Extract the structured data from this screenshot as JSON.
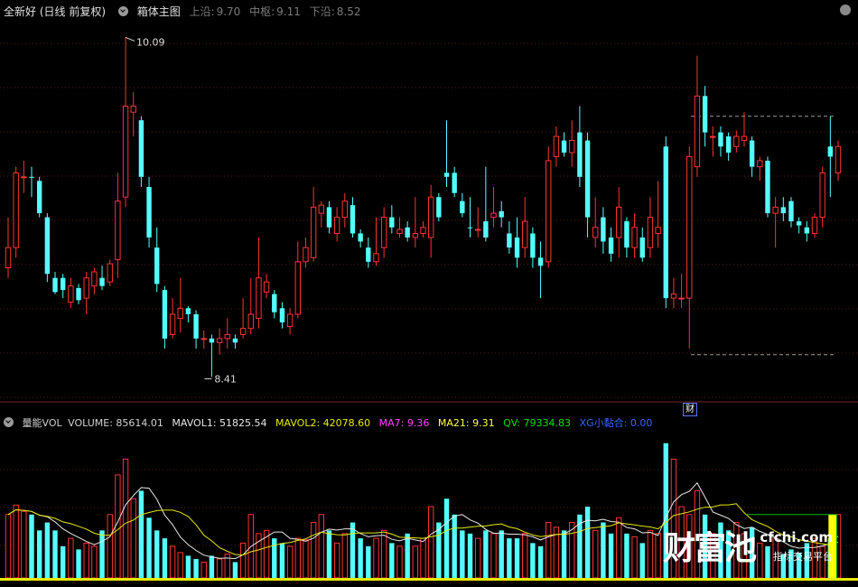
{
  "colors": {
    "up": "#ff3232",
    "down": "#54ffff",
    "bg": "#000000",
    "grid": "#5a1a1a",
    "ma_white": "#e8e8e8",
    "ma_yellow": "#e8e800",
    "mavol2": "#e8e800",
    "ma7": "#ff44ff",
    "ma21": "#ffff44",
    "qv": "#00e000",
    "xg": "#3366ff"
  },
  "price_panel": {
    "stock_name": "全新好",
    "period": "(日线 前复权)",
    "indicator": "箱体主图",
    "upper_label": "上沿:",
    "upper_value": "9.70",
    "center_label": "中枢:",
    "center_value": "9.11",
    "lower_label": "下沿:",
    "lower_value": "8.52",
    "high_marker": "10.09",
    "low_marker": "8.41",
    "finance_badge": "财",
    "icon_expand": "chevron-down-icon"
  },
  "volume_panel": {
    "indicator": "量能VOL",
    "volume": "VOLUME: 85614.01",
    "mavol1": "MAVOL1: 51825.54",
    "mavol2": "MAVOL2: 42078.60",
    "ma7": "MA7: 9.36",
    "ma21": "MA21: 9.31",
    "qv": "QV: 79334.83",
    "xg": "XG小黏合: 0.00",
    "icon_expand": "chevron-down-icon"
  },
  "watermark": {
    "brand": "财富池",
    "site": "cfchi.com",
    "slogan": "指标交易平台"
  },
  "chart_data": {
    "type": "candlestick",
    "price_range": [
      8.3,
      10.15
    ],
    "box": {
      "upper": 9.7,
      "center": 9.11,
      "lower": 8.52
    },
    "candles": [
      {
        "o": 8.95,
        "c": 9.05,
        "h": 9.2,
        "l": 8.9,
        "v": 40000,
        "up": true
      },
      {
        "o": 9.05,
        "c": 9.42,
        "h": 9.45,
        "l": 9.0,
        "v": 46000,
        "up": true
      },
      {
        "o": 9.4,
        "c": 9.4,
        "h": 9.48,
        "l": 9.32,
        "v": 42000,
        "up": true
      },
      {
        "o": 9.4,
        "c": 9.4,
        "h": 9.45,
        "l": 9.3,
        "v": 40000,
        "up": false
      },
      {
        "o": 9.38,
        "c": 9.22,
        "h": 9.4,
        "l": 9.2,
        "v": 30000,
        "up": false
      },
      {
        "o": 9.2,
        "c": 8.92,
        "h": 9.22,
        "l": 8.88,
        "v": 35000,
        "up": false
      },
      {
        "o": 8.9,
        "c": 8.83,
        "h": 8.93,
        "l": 8.82,
        "v": 30000,
        "up": false
      },
      {
        "o": 8.9,
        "c": 8.84,
        "h": 8.92,
        "l": 8.8,
        "v": 20000,
        "up": false
      },
      {
        "o": 8.78,
        "c": 8.86,
        "h": 8.9,
        "l": 8.75,
        "v": 25000,
        "up": true
      },
      {
        "o": 8.85,
        "c": 8.79,
        "h": 8.87,
        "l": 8.77,
        "v": 18000,
        "up": false
      },
      {
        "o": 8.8,
        "c": 8.9,
        "h": 8.93,
        "l": 8.72,
        "v": 22000,
        "up": true
      },
      {
        "o": 8.86,
        "c": 8.93,
        "h": 8.95,
        "l": 8.82,
        "v": 20000,
        "up": true
      },
      {
        "o": 8.9,
        "c": 8.86,
        "h": 8.96,
        "l": 8.84,
        "v": 30000,
        "up": false
      },
      {
        "o": 8.88,
        "c": 8.97,
        "h": 8.99,
        "l": 8.86,
        "v": 40000,
        "up": true
      },
      {
        "o": 8.99,
        "c": 9.28,
        "h": 9.42,
        "l": 8.9,
        "v": 65000,
        "up": true
      },
      {
        "o": 9.3,
        "c": 9.75,
        "h": 10.09,
        "l": 9.25,
        "v": 75000,
        "up": true
      },
      {
        "o": 9.72,
        "c": 9.75,
        "h": 9.82,
        "l": 9.6,
        "v": 50000,
        "up": true
      },
      {
        "o": 9.68,
        "c": 9.4,
        "h": 9.7,
        "l": 9.35,
        "v": 55000,
        "up": false
      },
      {
        "o": 9.35,
        "c": 9.1,
        "h": 9.4,
        "l": 9.05,
        "v": 38000,
        "up": false
      },
      {
        "o": 9.05,
        "c": 8.87,
        "h": 9.15,
        "l": 8.83,
        "v": 30000,
        "up": false
      },
      {
        "o": 8.84,
        "c": 8.6,
        "h": 8.86,
        "l": 8.55,
        "v": 25000,
        "up": false
      },
      {
        "o": 8.62,
        "c": 8.72,
        "h": 8.8,
        "l": 8.6,
        "v": 20000,
        "up": true
      },
      {
        "o": 8.7,
        "c": 8.75,
        "h": 8.9,
        "l": 8.63,
        "v": 16000,
        "up": true
      },
      {
        "o": 8.72,
        "c": 8.75,
        "h": 8.76,
        "l": 8.68,
        "v": 14000,
        "up": false
      },
      {
        "o": 8.72,
        "c": 8.6,
        "h": 8.74,
        "l": 8.55,
        "v": 12000,
        "up": false
      },
      {
        "o": 8.6,
        "c": 8.6,
        "h": 8.64,
        "l": 8.55,
        "v": 10000,
        "up": true
      },
      {
        "o": 8.6,
        "c": 8.58,
        "h": 8.62,
        "l": 8.41,
        "v": 14000,
        "up": false
      },
      {
        "o": 8.58,
        "c": 8.6,
        "h": 8.65,
        "l": 8.52,
        "v": 12000,
        "up": true
      },
      {
        "o": 8.6,
        "c": 8.62,
        "h": 8.7,
        "l": 8.55,
        "v": 15000,
        "up": true
      },
      {
        "o": 8.6,
        "c": 8.58,
        "h": 8.62,
        "l": 8.55,
        "v": 10000,
        "up": false
      },
      {
        "o": 8.62,
        "c": 8.65,
        "h": 8.8,
        "l": 8.6,
        "v": 22000,
        "up": true
      },
      {
        "o": 8.65,
        "c": 8.72,
        "h": 8.9,
        "l": 8.62,
        "v": 40000,
        "up": true
      },
      {
        "o": 8.7,
        "c": 8.9,
        "h": 9.1,
        "l": 8.65,
        "v": 28000,
        "up": true
      },
      {
        "o": 8.88,
        "c": 8.83,
        "h": 8.92,
        "l": 8.8,
        "v": 30000,
        "up": true
      },
      {
        "o": 8.82,
        "c": 8.73,
        "h": 8.84,
        "l": 8.7,
        "v": 25000,
        "up": false
      },
      {
        "o": 8.75,
        "c": 8.68,
        "h": 8.78,
        "l": 8.65,
        "v": 22000,
        "up": false
      },
      {
        "o": 8.66,
        "c": 8.72,
        "h": 8.75,
        "l": 8.62,
        "v": 20000,
        "up": true
      },
      {
        "o": 8.72,
        "c": 8.98,
        "h": 9.08,
        "l": 8.7,
        "v": 25000,
        "up": true
      },
      {
        "o": 8.98,
        "c": 9.05,
        "h": 9.1,
        "l": 8.95,
        "v": 24000,
        "up": true
      },
      {
        "o": 9.0,
        "c": 9.25,
        "h": 9.35,
        "l": 8.98,
        "v": 35000,
        "up": true
      },
      {
        "o": 9.22,
        "c": 9.26,
        "h": 9.28,
        "l": 9.15,
        "v": 40000,
        "up": true
      },
      {
        "o": 9.25,
        "c": 9.15,
        "h": 9.28,
        "l": 9.12,
        "v": 30000,
        "up": false
      },
      {
        "o": 9.12,
        "c": 9.2,
        "h": 9.25,
        "l": 9.08,
        "v": 22000,
        "up": true
      },
      {
        "o": 9.2,
        "c": 9.28,
        "h": 9.32,
        "l": 9.15,
        "v": 28000,
        "up": true
      },
      {
        "o": 9.26,
        "c": 9.12,
        "h": 9.3,
        "l": 9.1,
        "v": 35000,
        "up": false
      },
      {
        "o": 9.12,
        "c": 9.08,
        "h": 9.14,
        "l": 9.05,
        "v": 25000,
        "up": false
      },
      {
        "o": 9.05,
        "c": 8.98,
        "h": 9.1,
        "l": 8.95,
        "v": 20000,
        "up": false
      },
      {
        "o": 8.98,
        "c": 9.02,
        "h": 9.2,
        "l": 8.96,
        "v": 25000,
        "up": true
      },
      {
        "o": 9.05,
        "c": 9.2,
        "h": 9.25,
        "l": 9.0,
        "v": 30000,
        "up": true
      },
      {
        "o": 9.2,
        "c": 9.15,
        "h": 9.26,
        "l": 9.12,
        "v": 22000,
        "up": false
      },
      {
        "o": 9.14,
        "c": 9.12,
        "h": 9.2,
        "l": 9.1,
        "v": 20000,
        "up": true
      },
      {
        "o": 9.15,
        "c": 9.1,
        "h": 9.18,
        "l": 9.08,
        "v": 28000,
        "up": false
      },
      {
        "o": 9.1,
        "c": 9.12,
        "h": 9.3,
        "l": 9.05,
        "v": 20000,
        "up": true
      },
      {
        "o": 9.12,
        "c": 9.15,
        "h": 9.18,
        "l": 9.1,
        "v": 25000,
        "up": true
      },
      {
        "o": 9.1,
        "c": 9.3,
        "h": 9.36,
        "l": 9.0,
        "v": 45000,
        "up": true
      },
      {
        "o": 9.3,
        "c": 9.2,
        "h": 9.32,
        "l": 9.18,
        "v": 35000,
        "up": false
      },
      {
        "o": 9.4,
        "c": 9.42,
        "h": 9.68,
        "l": 9.35,
        "v": 50000,
        "up": false
      },
      {
        "o": 9.42,
        "c": 9.32,
        "h": 9.45,
        "l": 9.3,
        "v": 40000,
        "up": false
      },
      {
        "o": 9.28,
        "c": 9.22,
        "h": 9.32,
        "l": 9.2,
        "v": 30000,
        "up": false
      },
      {
        "o": 9.15,
        "c": 9.15,
        "h": 9.3,
        "l": 9.1,
        "v": 28000,
        "up": false
      },
      {
        "o": 9.14,
        "c": 9.14,
        "h": 9.25,
        "l": 9.1,
        "v": 25000,
        "up": true
      },
      {
        "o": 9.18,
        "c": 9.1,
        "h": 9.45,
        "l": 9.08,
        "v": 30000,
        "up": false
      },
      {
        "o": 9.2,
        "c": 9.22,
        "h": 9.35,
        "l": 9.15,
        "v": 28000,
        "up": true
      },
      {
        "o": 9.23,
        "c": 9.2,
        "h": 9.28,
        "l": 9.15,
        "v": 30000,
        "up": false
      },
      {
        "o": 9.12,
        "c": 9.05,
        "h": 9.18,
        "l": 9.02,
        "v": 25000,
        "up": false
      },
      {
        "o": 9.1,
        "c": 9.0,
        "h": 9.2,
        "l": 8.95,
        "v": 25000,
        "up": false
      },
      {
        "o": 9.05,
        "c": 9.18,
        "h": 9.3,
        "l": 9.0,
        "v": 28000,
        "up": true
      },
      {
        "o": 9.12,
        "c": 9.0,
        "h": 9.15,
        "l": 8.95,
        "v": 22000,
        "up": false
      },
      {
        "o": 9.0,
        "c": 8.96,
        "h": 9.08,
        "l": 8.8,
        "v": 20000,
        "up": false
      },
      {
        "o": 8.98,
        "c": 9.48,
        "h": 9.55,
        "l": 8.95,
        "v": 35000,
        "up": true
      },
      {
        "o": 9.5,
        "c": 9.6,
        "h": 9.65,
        "l": 9.45,
        "v": 32000,
        "up": true
      },
      {
        "o": 9.58,
        "c": 9.52,
        "h": 9.62,
        "l": 9.5,
        "v": 30000,
        "up": false
      },
      {
        "o": 9.52,
        "c": 9.58,
        "h": 9.68,
        "l": 9.45,
        "v": 35000,
        "up": true
      },
      {
        "o": 9.62,
        "c": 9.4,
        "h": 9.75,
        "l": 9.35,
        "v": 40000,
        "up": false
      },
      {
        "o": 9.58,
        "c": 9.2,
        "h": 9.62,
        "l": 9.1,
        "v": 45000,
        "up": false
      },
      {
        "o": 9.15,
        "c": 9.1,
        "h": 9.3,
        "l": 9.05,
        "v": 30000,
        "up": true
      },
      {
        "o": 9.2,
        "c": 9.08,
        "h": 9.25,
        "l": 9.02,
        "v": 35000,
        "up": false
      },
      {
        "o": 9.1,
        "c": 9.02,
        "h": 9.15,
        "l": 8.98,
        "v": 28000,
        "up": false
      },
      {
        "o": 9.1,
        "c": 9.25,
        "h": 9.35,
        "l": 9.0,
        "v": 38000,
        "up": true
      },
      {
        "o": 9.18,
        "c": 9.05,
        "h": 9.2,
        "l": 9.0,
        "v": 28000,
        "up": false
      },
      {
        "o": 9.05,
        "c": 9.15,
        "h": 9.22,
        "l": 9.0,
        "v": 26000,
        "up": true
      },
      {
        "o": 9.1,
        "c": 9.0,
        "h": 9.15,
        "l": 8.98,
        "v": 22000,
        "up": false
      },
      {
        "o": 9.05,
        "c": 9.2,
        "h": 9.3,
        "l": 9.0,
        "v": 30000,
        "up": true
      },
      {
        "o": 9.15,
        "c": 9.12,
        "h": 9.38,
        "l": 9.05,
        "v": 28000,
        "up": true
      },
      {
        "o": 9.55,
        "c": 8.8,
        "h": 9.6,
        "l": 8.75,
        "v": 85000,
        "up": false
      },
      {
        "o": 8.8,
        "c": 8.82,
        "h": 8.9,
        "l": 8.75,
        "v": 75000,
        "up": true
      },
      {
        "o": 8.8,
        "c": 8.8,
        "h": 8.92,
        "l": 8.75,
        "v": 45000,
        "up": true
      },
      {
        "o": 8.8,
        "c": 9.5,
        "h": 9.55,
        "l": 8.55,
        "v": 40000,
        "up": true
      },
      {
        "o": 9.45,
        "c": 9.8,
        "h": 10.0,
        "l": 9.4,
        "v": 55000,
        "up": true
      },
      {
        "o": 9.8,
        "c": 9.62,
        "h": 9.85,
        "l": 9.55,
        "v": 40000,
        "up": false
      },
      {
        "o": 9.6,
        "c": 9.6,
        "h": 9.65,
        "l": 9.5,
        "v": 28000,
        "up": true
      },
      {
        "o": 9.62,
        "c": 9.55,
        "h": 9.65,
        "l": 9.5,
        "v": 35000,
        "up": false
      },
      {
        "o": 9.6,
        "c": 9.52,
        "h": 9.62,
        "l": 9.48,
        "v": 30000,
        "up": false
      },
      {
        "o": 9.55,
        "c": 9.6,
        "h": 9.63,
        "l": 9.52,
        "v": 35000,
        "up": true
      },
      {
        "o": 9.6,
        "c": 9.58,
        "h": 9.72,
        "l": 9.55,
        "v": 28000,
        "up": true
      },
      {
        "o": 9.58,
        "c": 9.45,
        "h": 9.6,
        "l": 9.4,
        "v": 32000,
        "up": false
      },
      {
        "o": 9.45,
        "c": 9.48,
        "h": 9.5,
        "l": 9.38,
        "v": 22000,
        "up": true
      },
      {
        "o": 9.48,
        "c": 9.22,
        "h": 9.5,
        "l": 9.2,
        "v": 20000,
        "up": false
      },
      {
        "o": 9.22,
        "c": 9.25,
        "h": 9.3,
        "l": 9.05,
        "v": 25000,
        "up": true
      },
      {
        "o": 9.25,
        "c": 9.22,
        "h": 9.3,
        "l": 9.18,
        "v": 15000,
        "up": false
      },
      {
        "o": 9.28,
        "c": 9.18,
        "h": 9.3,
        "l": 9.15,
        "v": 18000,
        "up": false
      },
      {
        "o": 9.18,
        "c": 9.16,
        "h": 9.2,
        "l": 9.12,
        "v": 16000,
        "up": false
      },
      {
        "o": 9.15,
        "c": 9.12,
        "h": 9.18,
        "l": 9.08,
        "v": 22000,
        "up": false
      },
      {
        "o": 9.12,
        "c": 9.2,
        "h": 9.22,
        "l": 9.1,
        "v": 25000,
        "up": true
      },
      {
        "o": 9.2,
        "c": 9.42,
        "h": 9.45,
        "l": 9.15,
        "v": 20000,
        "up": true
      },
      {
        "o": 9.5,
        "c": 9.55,
        "h": 9.7,
        "l": 9.3,
        "v": 25000,
        "up": false
      },
      {
        "o": 9.42,
        "c": 9.55,
        "h": 9.58,
        "l": 9.38,
        "v": 40000,
        "up": true
      }
    ]
  }
}
